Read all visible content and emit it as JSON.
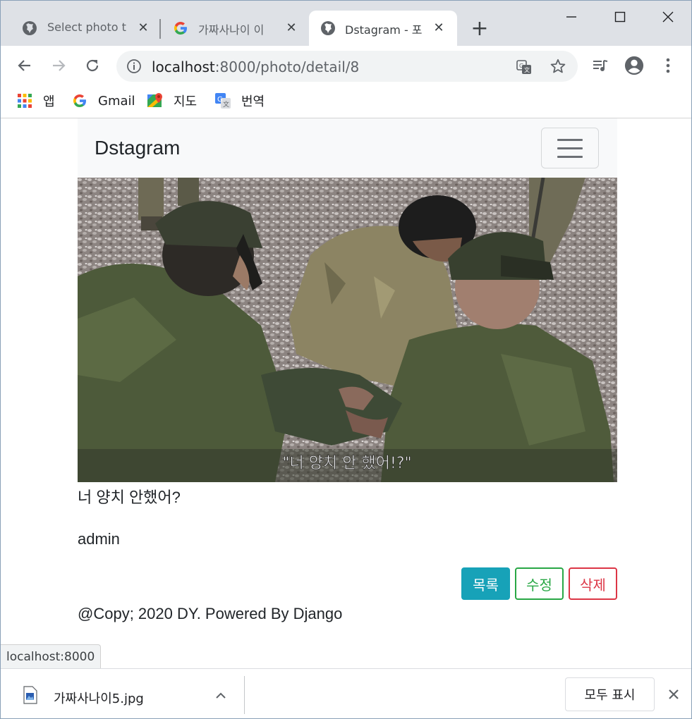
{
  "tabs": [
    {
      "title": "Select photo t",
      "icon": "globe-icon",
      "active": false
    },
    {
      "title": "가짜사나이 이",
      "icon": "google-icon",
      "active": false
    },
    {
      "title": "Dstagram - 포",
      "icon": "globe-icon",
      "active": true
    }
  ],
  "address_bar": {
    "host": "localhost",
    "path": ":8000/photo/detail/8"
  },
  "bookmarks": [
    {
      "label": "앱",
      "icon": "apps-grid-icon"
    },
    {
      "label": "Gmail",
      "icon": "google-icon"
    },
    {
      "label": "지도",
      "icon": "maps-icon"
    },
    {
      "label": "번역",
      "icon": "translate-icon"
    }
  ],
  "site": {
    "brand": "Dstagram"
  },
  "post": {
    "image_alt": "photo",
    "subtitle_overlay": "\"너 양치 안 했어!?\"",
    "text": "너 양치 안했어?",
    "author": "admin"
  },
  "actions": {
    "list": "목록",
    "edit": "수정",
    "delete": "삭제"
  },
  "footer": {
    "text": "@Copy; 2020 DY. Powered By Django"
  },
  "status_bar": {
    "text": "localhost:8000"
  },
  "download_shelf": {
    "filename": "가짜사나이5.jpg",
    "show_all": "모두 표시"
  },
  "colors": {
    "btn_info": "#17a2b8",
    "btn_success": "#28a745",
    "btn_danger": "#dc3545",
    "navbar_bg": "#f8f9fa",
    "tabstrip_bg": "#dee1e6"
  }
}
